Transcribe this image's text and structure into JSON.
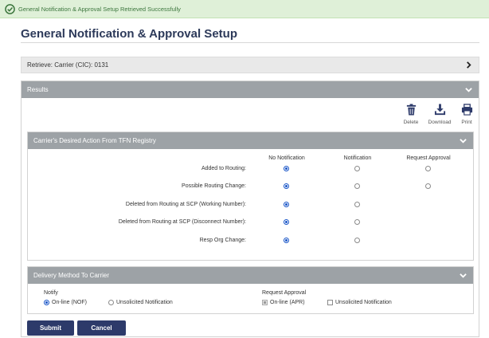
{
  "banner": {
    "message": "General Notification & Approval Setup Retrieved Successfully"
  },
  "page": {
    "title": "General Notification & Approval Setup"
  },
  "retrieve": {
    "label": "Retrieve: Carrier (CIC): 0131"
  },
  "results": {
    "label": "Results",
    "actions": [
      {
        "icon": "trash-icon",
        "label": "Delete"
      },
      {
        "icon": "download-icon",
        "label": "Download"
      },
      {
        "icon": "printer-icon",
        "label": "Print"
      }
    ]
  },
  "registry": {
    "title": "Carrier's Desired Action From TFN Registry",
    "columns": [
      "No Notification",
      "Notification",
      "Request Approval"
    ],
    "rows": [
      {
        "label": "Added to Routing:",
        "selected": "No Notification",
        "has_approval": true
      },
      {
        "label": "Possible Routing Change:",
        "selected": "No Notification",
        "has_approval": true
      },
      {
        "label": "Deleted from Routing at SCP (Working Number):",
        "selected": "No Notification",
        "has_approval": false
      },
      {
        "label": "Deleted from Routing at SCP (Disconnect Number):",
        "selected": "No Notification",
        "has_approval": false
      },
      {
        "label": "Resp Org Change:",
        "selected": "No Notification",
        "has_approval": false
      }
    ]
  },
  "delivery": {
    "title": "Delivery Method To Carrier",
    "notify": {
      "label": "Notify",
      "options": [
        {
          "label": "On-line (NOF)",
          "selected": true
        },
        {
          "label": "Unsolicited Notification",
          "selected": false
        }
      ]
    },
    "approval": {
      "label": "Request Approval",
      "options": [
        {
          "label": "On-line (APR)",
          "checked": true,
          "disabled": true
        },
        {
          "label": "Unsolicited Notification",
          "checked": false,
          "disabled": false
        }
      ]
    }
  },
  "buttons": {
    "submit": "Submit",
    "cancel": "Cancel"
  },
  "colors": {
    "primary": "#2d3a6a",
    "header_gray": "#9da2a6",
    "success_bg": "#dff0d8",
    "radio_selected": "#1a56c8"
  }
}
